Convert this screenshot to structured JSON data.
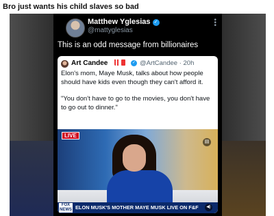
{
  "caption": "Bro just wants his child slaves so bad",
  "tweet": {
    "author_name": "Matthew Yglesias",
    "author_handle": "@mattyglesias",
    "text": "This is an odd message from billionaires",
    "more_icon": "•\n•\n•"
  },
  "quote": {
    "author_name": "Art Candee",
    "handle": "@ArtCandee",
    "time": "20h",
    "meta": "@ArtCandee · 20h",
    "text_1": "Elon's mom, Maye Musk, talks about how people should have kids even though they can't afford it.",
    "text_2": "\"You don't have to go to the movies, you don't have to go out to dinner.\"",
    "live_badge": "LIVE",
    "chyron": "ELON MUSK'S MOTHER MAYE MUSK LIVE ON F&F",
    "network_logo": "FOX NEWS"
  },
  "colors": {
    "verified_blue": "#1d9bf0",
    "live_red": "#d0021b",
    "chyron_blue": "#0b2a6b"
  }
}
